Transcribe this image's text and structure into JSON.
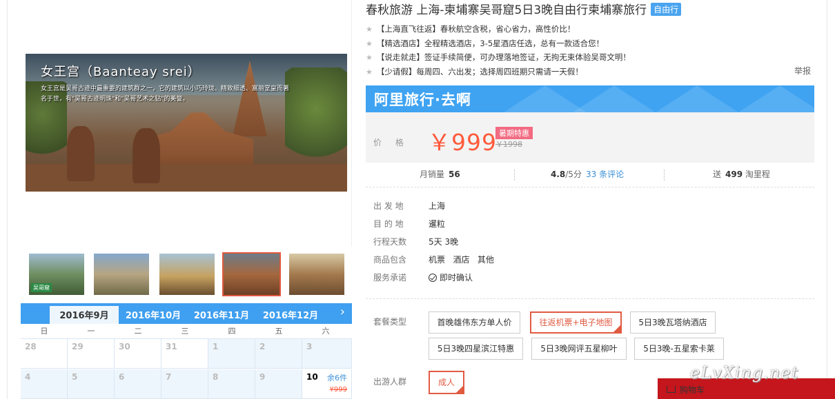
{
  "title": "春秋旅游   上海-柬埔寨吴哥窟5日3晚自由行柬埔寨旅行",
  "tag": "自由行",
  "features": [
    "【上海直飞往返】春秋航空含税，省心省力，高性价比！",
    "【精选酒店】全程精选酒店，3-5星酒店任选，总有一款适合您！",
    "【说走就走】签证手续简便，可办理落地签证，无拘无束体验吴哥文明！",
    "【少请假】每周四、六出发；选择周四班期只需请一天假！"
  ],
  "report": "举报",
  "brand": "阿里旅行·去啊",
  "price": {
    "label": "价 格",
    "value": "￥999",
    "promo": "暑期特惠",
    "original": "￥1998"
  },
  "stats": {
    "sales_label": "月销量",
    "sales_value": "56",
    "rating": "4.8",
    "rating_suffix": "/5分",
    "reviews_count": "33",
    "reviews_label": "条评论",
    "points_prefix": "送",
    "points_value": "499",
    "points_suffix": "淘里程"
  },
  "info": [
    {
      "key": "出 发 地",
      "value": "上海"
    },
    {
      "key": "目 的 地",
      "value": "暹粒"
    },
    {
      "key": "行程天数",
      "value": "5天 3晚"
    },
    {
      "key": "商品包含",
      "value": "机票   酒店   其他"
    },
    {
      "key": "服务承诺",
      "value": "即时确认"
    }
  ],
  "package": {
    "label": "套餐类型",
    "options": [
      "首晚雄伟东方单人价",
      "往返机票+电子地图",
      "5日3晚瓦塔纳酒店",
      "5日3晚四星滨江特惠",
      "5日3晚网评五星柳叶",
      "5日3晚-五星索卡莱"
    ],
    "selected": 1
  },
  "crowd": {
    "label": "出游人群",
    "option": "成人"
  },
  "gallery": {
    "main_title": "女王宫（Baanteay srei）",
    "main_caption": "女王宫是吴哥古迹中最重要的建筑群之一，它的建筑以小巧玲珑、精致细透、富丽堂皇而著名于世，有\"吴哥古迹明珠\"和\"吴哥艺术之钻\"的美誉。",
    "thumb_badge": "吴哥窟"
  },
  "calendar": {
    "months": [
      "2016年9月",
      "2016年10月",
      "2016年11月",
      "2016年12月"
    ],
    "next_icon": "chevron-right-icon",
    "weekdays": [
      "日",
      "一",
      "二",
      "三",
      "四",
      "五",
      "六"
    ],
    "rows": [
      [
        "28",
        "29",
        "30",
        "31",
        "1",
        "2",
        "3"
      ],
      [
        "4",
        "5",
        "6",
        "7",
        "8",
        "9",
        "10"
      ]
    ],
    "available": {
      "day": "10",
      "stock": "余6件",
      "price": "¥999"
    }
  },
  "cart": {
    "label": "购物车",
    "icon": "cart-icon"
  },
  "watermark": "eLvXing.net",
  "colors": {
    "accent": "#3fa3f2",
    "price": "#ff5a3c",
    "selected": "#e05a40",
    "promo": "#f26b82",
    "cart": "#c4161c"
  }
}
